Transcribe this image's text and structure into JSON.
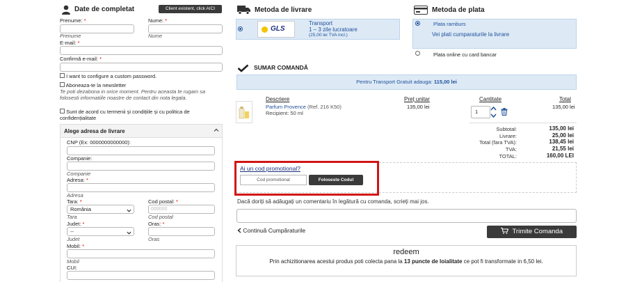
{
  "customer": {
    "title": "Date de completat",
    "existing_client_btn": "Client existent, click AICI",
    "first_name_label": "Prenume:",
    "first_name_hint": "Prenume",
    "last_name_label": "Nume:",
    "last_name_hint": "Nume",
    "email_label": "E-mail:",
    "confirm_email_label": "Confirmă e-mail:",
    "custom_password_label": "I want to configure a custom password.",
    "newsletter_label": "Aboneaza-te la newsletter",
    "newsletter_note": "Te poti dezabona in orice moment. Pentru aceasta te rugam sa folosesti informatiile noastre de contact din nota legala.",
    "terms_label": "Sunt de acord cu termenii și condițiile și cu politica de confidențialitate",
    "required_mark": "*"
  },
  "address": {
    "title": "Alege adresa de livrare",
    "cnp_label": "CNP (Ex: 0000000000000):",
    "company_label": "Companie:",
    "company_hint": "Companie",
    "address_label": "Adresa:",
    "address_hint": "Adresa",
    "country_label": "Tara:",
    "country_value": "România",
    "country_hint": "Tara",
    "postal_label": "Cod postal:",
    "postal_placeholder": "000000",
    "postal_hint": "Cod postal",
    "county_label": "Judet:",
    "county_value": "--",
    "county_hint": "Judet",
    "city_label": "Oras:",
    "city_hint": "Oras",
    "mobile_label": "Mobil:",
    "mobile_hint": "Mobil",
    "cui_label": "CUI:"
  },
  "delivery": {
    "title": "Metoda de livrare",
    "option_name": "Transport",
    "option_time": "1 – 3 zile lucratoare",
    "option_price": "(25,00 lei TVA incl.)",
    "carrier_logo": "GLS"
  },
  "payment": {
    "title": "Metoda de plata",
    "option1": "Plata ramburs",
    "option1_desc": "Vei plati cumparaturile la livrare",
    "option2": "Plata online cu card bancar"
  },
  "summary": {
    "title": "SUMAR COMANDĂ",
    "free_shipping_prefix": "Pentru Transport Gratuit adauga:",
    "free_shipping_amount": "115,00 lei",
    "col_desc": "Descriere",
    "col_price": "Preț unitar",
    "col_qty": "Cantitate",
    "col_total": "Total",
    "product_name": "Parfum Provence",
    "product_ref": "(Ref. 216 K50)",
    "product_variant": "Recipient: 50 ml",
    "product_price": "135,00 lei",
    "product_qty": "1",
    "product_total": "135,00 lei",
    "subtotal_label": "Subtotal:",
    "subtotal_value": "135,00 lei",
    "shipping_label": "Livrare:",
    "shipping_value": "25,00 lei",
    "total_no_vat_label": "Total (fara TVA):",
    "total_no_vat_value": "138,45 lei",
    "vat_label": "TVA:",
    "vat_value": "21,55 lei",
    "total_label": "TOTAL:",
    "total_value": "160,00 LEI"
  },
  "promo": {
    "question": "Ai un cod promotional?",
    "input_placeholder": "Cod promotional",
    "apply_button": "Foloseste Codul"
  },
  "comment": {
    "prompt": "Dacă doriți să adăugați un comentariu în legătură cu comanda, scrieți mai jos."
  },
  "actions": {
    "continue_shopping": "Continuă Cumpăraturile",
    "submit_order": "Trimite Comanda"
  },
  "loyalty": {
    "title": "redeem",
    "text_prefix": "Prin achizitionarea acestui produs poti colecta pana la",
    "points": "13 puncte de loialitate",
    "text_suffix": "ce pot fi transformate in 6,50 lei."
  },
  "colors": {
    "accent_blue": "#1f4f9a",
    "panel_blue": "#ddeaf6",
    "highlight_red": "#d21414",
    "dark_button": "#3a3a3a"
  }
}
